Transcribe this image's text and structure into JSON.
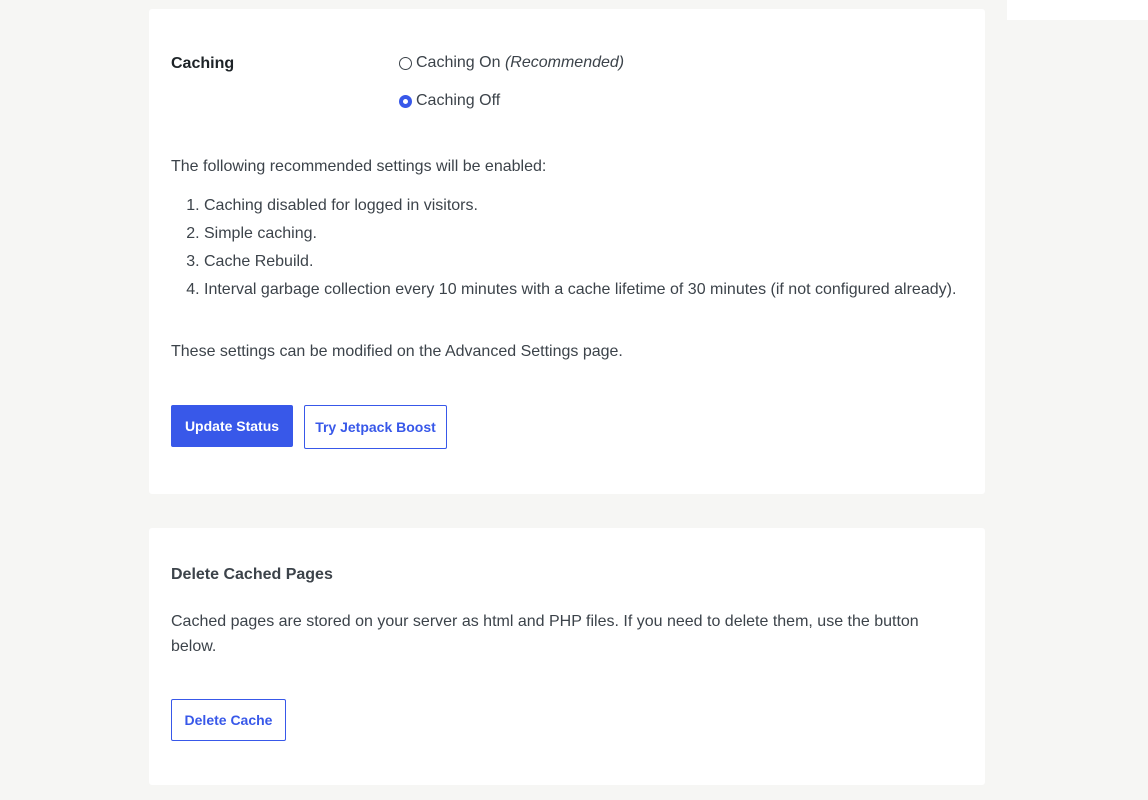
{
  "caching": {
    "label": "Caching",
    "options": [
      {
        "label": "Caching On",
        "note": "(Recommended)",
        "selected": false
      },
      {
        "label": "Caching Off",
        "note": "",
        "selected": true
      }
    ],
    "intro": "The following recommended settings will be enabled:",
    "settings": [
      "Caching disabled for logged in visitors.",
      "Simple caching.",
      "Cache Rebuild.",
      "Interval garbage collection every 10 minutes with a cache lifetime of 30 minutes (if not configured already)."
    ],
    "note": "These settings can be modified on the Advanced Settings page.",
    "update_button": "Update Status",
    "jetpack_button": "Try Jetpack Boost"
  },
  "delete_cache": {
    "title": "Delete Cached Pages",
    "description": "Cached pages are stored on your server as html and PHP files. If you need to delete them, use the button below.",
    "button": "Delete Cache"
  },
  "colors": {
    "accent": "#3858e9",
    "background": "#f6f6f4",
    "card": "#ffffff",
    "text": "#3c434a"
  }
}
